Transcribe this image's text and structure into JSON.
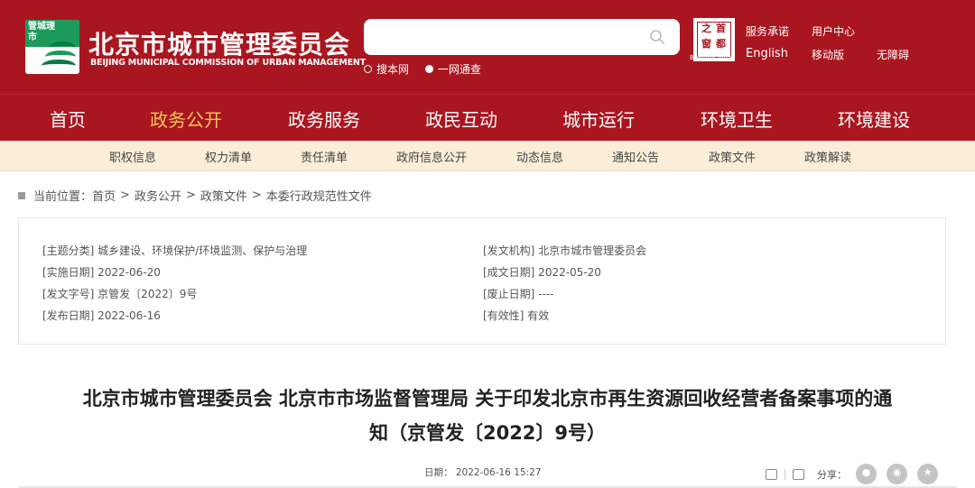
{
  "header": {
    "logo_text": "管城理市",
    "title": "北京市城市管理委员会",
    "subtitle": "BEIJING MUNICIPAL COMMISSION OF URBAN MANAGEMENT",
    "search": {
      "value": "",
      "placeholder": ""
    },
    "search_options": [
      {
        "label": "搜本网",
        "selected": false
      },
      {
        "label": "一网通查",
        "selected": true
      }
    ],
    "seal_chars": [
      "之",
      "首",
      "窗",
      "都"
    ],
    "seal_caption": "Beijing-China",
    "top_links": [
      "服务承诺",
      "用户中心",
      "English",
      "移动版",
      "无障碍"
    ]
  },
  "main_nav": {
    "items": [
      "首页",
      "政务公开",
      "政务服务",
      "政民互动",
      "城市运行",
      "环境卫生",
      "环境建设"
    ],
    "active": "政务公开",
    "active_color": "#f5c35a"
  },
  "sub_nav": {
    "items": [
      "职权信息",
      "权力清单",
      "责任清单",
      "政府信息公开",
      "动态信息",
      "通知公告",
      "政策文件",
      "政策解读"
    ]
  },
  "breadcrumb": {
    "prefix": "当前位置：",
    "items": [
      "首页",
      "政务公开",
      "政策文件",
      "本委行政规范性文件"
    ]
  },
  "info": {
    "left": [
      "[主题分类] 城乡建设、环境保护/环境监测、保护与治理",
      "[实施日期] 2022-06-20",
      "[发文字号] 京管发〔2022〕9号",
      "[发布日期] 2022-06-16"
    ],
    "right": [
      "[发文机构] 北京市城市管理委员会",
      "[成文日期] 2022-05-20",
      "[废止日期] ----",
      "[有效性] 有效"
    ]
  },
  "article": {
    "title_line1": "北京市城市管理委员会 北京市市场监督管理局 关于印发北京市再生资源回收经营者备案事项的通",
    "title_line2": "知（京管发〔2022〕9号）",
    "date": "日期： 2022-06-16 15:27",
    "share_label": "分享："
  },
  "colors": {
    "brand_red": "#a9161f",
    "subnav_bg": "#fbeed8",
    "logo_green": "#1b9a5b"
  }
}
